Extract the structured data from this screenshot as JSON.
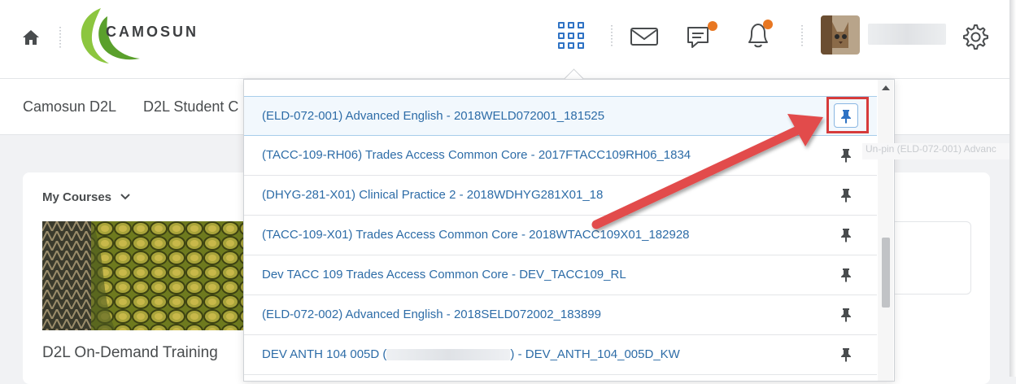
{
  "header": {
    "logo_text": "CAMOSUN",
    "icons": [
      "home-icon",
      "waffle-icon",
      "mail-icon",
      "chat-icon",
      "bell-icon",
      "gear-icon"
    ],
    "notification_color": "#e87722",
    "accent": "#2e72c4"
  },
  "nav": {
    "items": [
      "Camosun D2L",
      "D2L Student C"
    ]
  },
  "widget": {
    "title": "My Courses",
    "course_title": "D2L On-Demand Training"
  },
  "dropdown": {
    "courses": [
      {
        "label": "(ELD-072-001) Advanced English - 2018WELD072001_181525",
        "pinned": true
      },
      {
        "label": "(TACC-109-RH06) Trades Access Common Core - 2017FTACC109RH06_1834",
        "pinned": false
      },
      {
        "label": "(DHYG-281-X01) Clinical Practice 2 - 2018WDHYG281X01_18",
        "pinned": false
      },
      {
        "label": "(TACC-109-X01) Trades Access Common Core - 2018WTACC109X01_182928",
        "pinned": false
      },
      {
        "label": "Dev TACC 109 Trades Access Common Core - DEV_TACC109_RL",
        "pinned": false
      },
      {
        "label": "(ELD-072-002) Advanced English - 2018SELD072002_183899",
        "pinned": false
      },
      {
        "label_prefix": "DEV ANTH 104 005D (",
        "label_suffix": ") - DEV_ANTH_104_005D_KW",
        "pinned": false
      }
    ],
    "tooltip": "Un-pin (ELD-072-001) Advanc",
    "highlight_color": "#d63b3b"
  }
}
